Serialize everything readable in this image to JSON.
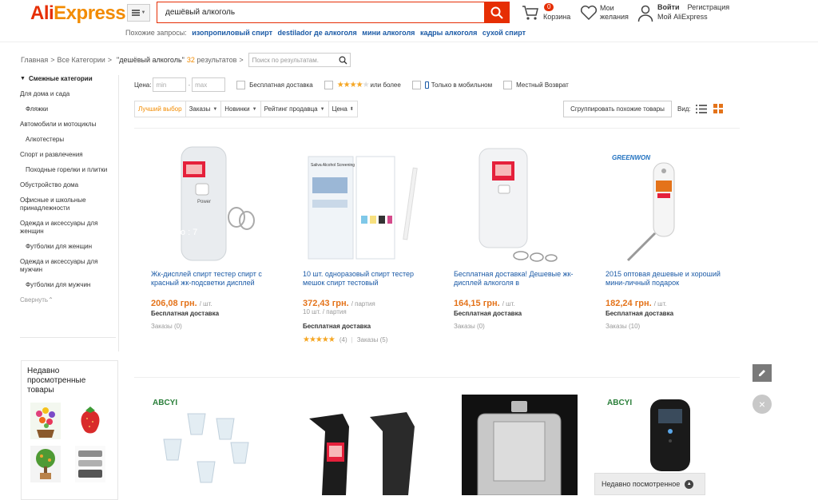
{
  "header": {
    "logo_ali": "Ali",
    "logo_express": "Express",
    "search_value": "дешёвый алкоголь",
    "related_label": "Похожие запросы:",
    "related": [
      "изопропиловый спирт",
      "destilador де алкоголя",
      "мини алкоголя",
      "кадры алкоголя",
      "сухой спирт"
    ],
    "cart_count": "0",
    "cart_label": "Корзина",
    "wish_line1": "Мои",
    "wish_line2": "желания",
    "signin": "Войти",
    "register": "Регистрация",
    "my_ali": "Мой AliExpress"
  },
  "breadcrumb": {
    "home": "Главная",
    "all": "Все Категории",
    "query": "\"дешёвый алкоголь\"",
    "count": "32",
    "results": "результатов",
    "search_placeholder": "Поиск по результатам."
  },
  "sidebar": {
    "title": "Смежные категории",
    "items": [
      {
        "label": "Для дома и сада",
        "sub": false
      },
      {
        "label": "Фляжки",
        "sub": true
      },
      {
        "label": "Автомобили и мотоциклы",
        "sub": false
      },
      {
        "label": "Алкотестеры",
        "sub": true
      },
      {
        "label": "Спорт и развлечения",
        "sub": false
      },
      {
        "label": "Походные горелки и плитки",
        "sub": true
      },
      {
        "label": "Обустройство дома",
        "sub": false
      },
      {
        "label": "Офисные и школьные принадлежности",
        "sub": false
      },
      {
        "label": "Одежда и аксессуары для женщин",
        "sub": false
      },
      {
        "label": "Футболки для женщин",
        "sub": true
      },
      {
        "label": "Одежда и аксессуары для мужчин",
        "sub": false
      },
      {
        "label": "Футболки для мужчин",
        "sub": true
      }
    ],
    "collapse": "Свернуть",
    "recent_title": "Недавно просмотренные товары"
  },
  "filters": {
    "price_label": "Цена:",
    "min_placeholder": "min",
    "max_placeholder": "max",
    "free_shipping": "Бесплатная доставка",
    "rating_suffix": "или более",
    "mobile_only": "Только в мобильном",
    "local_return": "Местный Возврат"
  },
  "sort": {
    "best": "Лучший выбор",
    "orders": "Заказы",
    "new": "Новинки",
    "seller_rating": "Рейтинг продавца",
    "price": "Цена",
    "group_similar": "Сгруппировать похожие товары",
    "view_label": "Вид:"
  },
  "products": [
    {
      "title": "Жк-дисплей спирт тестер спирт с красный жк-подсветки дисплей",
      "price": "206,08 грн.",
      "unit": "/ шт.",
      "shipping": "Бесплатная доставка",
      "orders": "Заказы (0)"
    },
    {
      "title": "10 шт. одноразовый спирт тестер мешок спирт тестовый",
      "price": "372,43 грн.",
      "unit": "/ партия",
      "extra": "10 шт. / партия",
      "shipping": "Бесплатная доставка",
      "rating_count": "(4)",
      "orders": "Заказы (5)"
    },
    {
      "title": "Бесплатная доставка! Дешевые жк-дисплей алкоголя в",
      "price": "164,15 грн.",
      "unit": "/ шт.",
      "shipping": "Бесплатная доставка",
      "orders": "Заказы (0)"
    },
    {
      "title": "2015 оптовая дешевые и хороший мини-личный подарок",
      "price": "182,24 грн.",
      "unit": "/ шт.",
      "shipping": "Бесплатная доставка",
      "orders": "Заказы (10)"
    }
  ],
  "image_text": {
    "power": "Power",
    "watermark": "ore No : 7",
    "saliva": "Saliva Alcohol Screening Test",
    "brand_greenwon": "GREENWON",
    "brand_abcyi": "ABCYI"
  },
  "recent_bar": "Недавно посмотренное",
  "colors": {
    "accent": "#e62e04",
    "orange": "#f28b00",
    "price": "#e4731a",
    "link": "#1b5aa6"
  }
}
